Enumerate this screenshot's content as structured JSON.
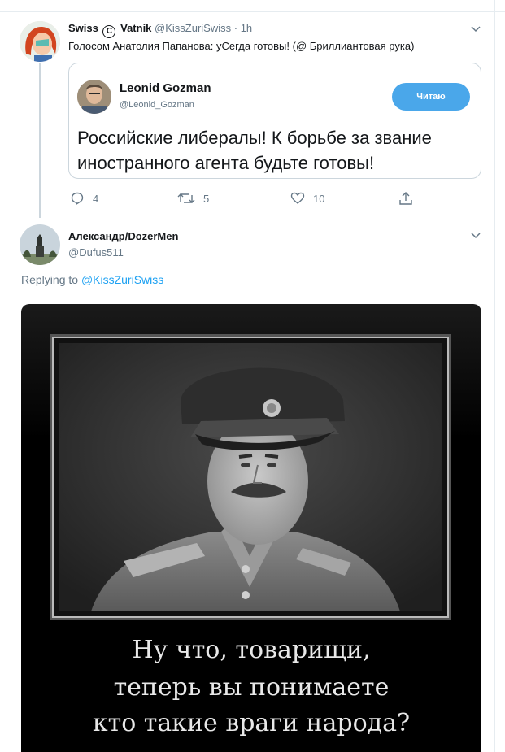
{
  "tweet1": {
    "display_name": "Swiss",
    "copyright_mark": "C",
    "display_name2": "Vatnik",
    "handle": "@KissZuriSwiss",
    "time": "· 1h",
    "text": "Голосом Анатолия Папанова: уСегда готовы! (@ Бриллиантовая рука)"
  },
  "quote": {
    "name": "Leonid Gozman",
    "handle": "@Leonid_Gozman",
    "follow_label": "Читаю",
    "text": "Российские либералы! К борьбе за звание иностранного агента будьте готовы!"
  },
  "actions": {
    "replies": "4",
    "retweets": "5",
    "likes": "10"
  },
  "tweet2": {
    "display_name": "Александр/DozerMen",
    "handle": "@Dufus511",
    "replying_prefix": "Replying to",
    "replying_handle": "@KissZuriSwiss"
  },
  "meme": {
    "caption_lines": [
      "Ну что, товарищи,",
      "теперь вы понимаете",
      "кто такие враги народа?"
    ]
  },
  "colors": {
    "accent": "#1da1f2",
    "follow_button": "#4aa7ea",
    "muted_text": "#657786",
    "divider": "#e6ecf0"
  }
}
